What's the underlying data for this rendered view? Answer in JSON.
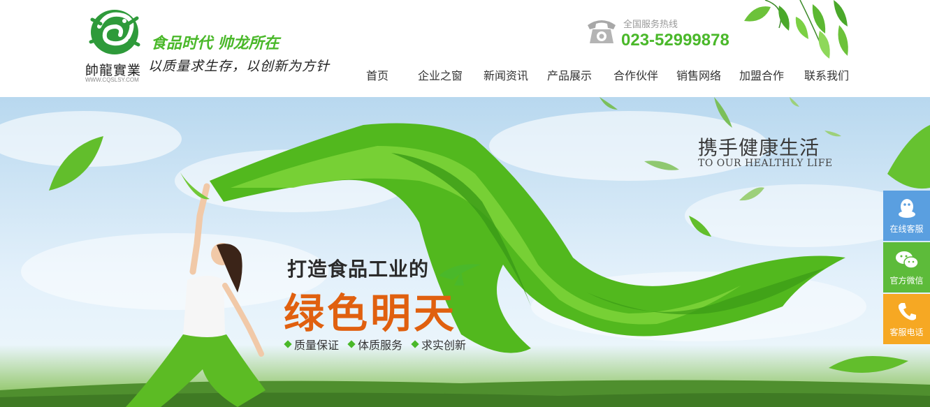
{
  "brand": {
    "logo_chars": "帥龍實業",
    "logo_url": "WWW.CQSLSY.COM",
    "slogan_primary": "食品时代 帅龙所在",
    "slogan_secondary": "以质量求生存，以创新为方针"
  },
  "hotline": {
    "label": "全国服务热线",
    "number": "023-52999878",
    "icon": "telephone-icon"
  },
  "nav": {
    "items": [
      {
        "label": "首页"
      },
      {
        "label": "企业之窗"
      },
      {
        "label": "新闻资讯"
      },
      {
        "label": "产品展示"
      },
      {
        "label": "合作伙伴"
      },
      {
        "label": "销售网络"
      },
      {
        "label": "加盟合作"
      },
      {
        "label": "联系我们"
      }
    ]
  },
  "banner": {
    "tagline_cn": "携手健康生活",
    "tagline_en": "TO OUR HEALTHLY LIFE",
    "headline": "打造食品工业的",
    "headline_big": "绿色明天",
    "features": [
      "质量保证",
      "体质服务",
      "求实创新"
    ]
  },
  "side": {
    "items": [
      {
        "label": "在线客服",
        "icon": "qq-icon",
        "color": "#5a9fe0"
      },
      {
        "label": "官方微信",
        "icon": "wechat-icon",
        "color": "#5dbb3a"
      },
      {
        "label": "客服电话",
        "icon": "phone-icon",
        "color": "#f6a823"
      }
    ]
  },
  "colors": {
    "accent_green": "#4ab82a",
    "headline_orange": "#e0600f"
  }
}
